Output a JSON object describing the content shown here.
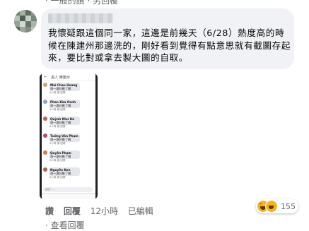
{
  "top_partial_text": "· 一般的讚 · 另回覆",
  "comment": {
    "author_name": "",
    "text": "我懷疑跟這個同一家，這邊是前幾天（6/28）熱度高的時候在陳建州那邊洗的，剛好看到覺得有點意思就有截圖存起來，要比對或拿去製大圖的自取。",
    "actions": {
      "like": "讚",
      "reply": "回覆",
      "time": "12小時",
      "edited": "已編輯"
    },
    "reactions": {
      "count": "155"
    }
  },
  "screenshot": {
    "header": "黑人 陳建州",
    "messages": [
      {
        "name": "Mai Chau Hoang",
        "text": "哥～讚好數了喔",
        "meta": "6小時 讚 回覆"
      },
      {
        "name": "Phan Kim Oanh",
        "text": "哥～讚好數了喔",
        "meta": "6小時 讚 回覆"
      },
      {
        "name": "Quỳnh Như Hà",
        "text": "哥～讚好數了喔",
        "meta": "6小時 讚 回覆"
      },
      {
        "name": "Tường Vân Phạm",
        "text": "哥～讚好數了喔",
        "meta": "6小時 讚 回覆"
      },
      {
        "name": "Quyên Phạm",
        "text": "哥～讚好數了喔",
        "meta": "6小時 讚 回覆"
      },
      {
        "name": "Nguyễn Ken",
        "text": "哥～讚好數了喔",
        "meta": "6小時 讚 回覆"
      }
    ],
    "input_placeholder": "留言……"
  },
  "bottom_partial_text": "· 查看回覆"
}
